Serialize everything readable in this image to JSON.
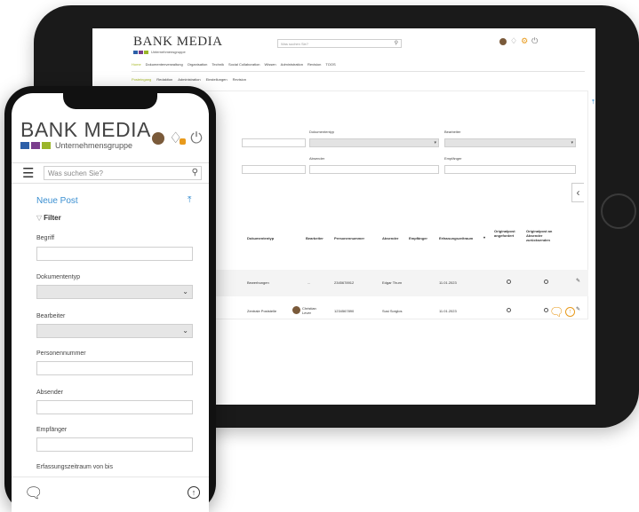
{
  "brand": {
    "name": "BANK MEDIA",
    "subtitle": "Unternehmensgruppe",
    "colors": {
      "blue": "#2c5fa8",
      "purple": "#7a3d8c",
      "green": "#9bb52a",
      "accent_orange": "#e89a1c",
      "accent_blue": "#3a8fd1"
    }
  },
  "search": {
    "placeholder": "Was suchen Sie?"
  },
  "tablet": {
    "nav": [
      "Home",
      "Dokumentenverwaltung",
      "Organisation",
      "Technik",
      "Social Collaboration",
      "Wissen",
      "Administration",
      "Revision",
      "TOOS"
    ],
    "subnav": [
      "Posteingang",
      "Redaktion",
      "Administration",
      "Einstellungen",
      "Revision"
    ],
    "labels": {
      "dokumententyp": "Dokumententyp",
      "bearbeiter": "Bearbeiter",
      "absender": "Absender",
      "empfaenger": "Empfänger"
    },
    "table": {
      "headers": [
        "Dokumententyp",
        "Bearbeiter",
        "Personennummer",
        "Absender",
        "Empfänger",
        "Erfassungszeitraum",
        "Originalpost angefordert",
        "Originalpost an Absender zurücksenden"
      ],
      "rows": [
        {
          "dokumententyp": "Bewerbungen",
          "bearbeiter": "...",
          "personennummer": "2345678912",
          "absender": "Edgar Thurn",
          "empfaenger": "",
          "datum": "11.01.2023"
        },
        {
          "dokumententyp": "Zentrale Poststelle",
          "bearbeiter": "Christian Lever",
          "personennummer": "1234567890",
          "absender": "Susi Sorglos",
          "empfaenger": "",
          "datum": "11.01.2023"
        }
      ]
    }
  },
  "phone": {
    "title": "Neue Post",
    "filter": "Filter",
    "fields": {
      "begriff": "Begriff",
      "dokumententyp": "Dokumententyp",
      "bearbeiter": "Bearbeiter",
      "personennummer": "Personennummer",
      "absender": "Absender",
      "empfaenger": "Empfänger",
      "zeitraum": "Erfassungszeitraum von bis"
    }
  },
  "icons": [
    "search-icon",
    "bell-icon",
    "gear-icon",
    "power-icon",
    "upload-icon",
    "filter-icon",
    "chevron-down-icon",
    "chat-icon",
    "arrow-up-icon",
    "menu-icon",
    "edit-icon",
    "chevron-left-icon"
  ]
}
